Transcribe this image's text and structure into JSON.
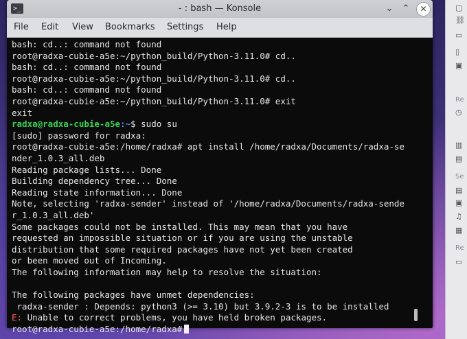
{
  "window": {
    "title": "- : bash — Konsole",
    "app_icon": "terminal-icon",
    "minimize_glyph": "⌄",
    "maximize_glyph": "⌃",
    "close_glyph": "✕"
  },
  "menu": [
    "File",
    "Edit",
    "View",
    "Bookmarks",
    "Settings",
    "Help"
  ],
  "terminal": {
    "lines": [
      "bash: cd..: command not found",
      "root@radxa-cubie-a5e:~/python_build/Python-3.11.0# cd..",
      "bash: cd..: command not found",
      "root@radxa-cubie-a5e:~/python_build/Python-3.11.0# cd..",
      "bash: cd..: command not found",
      "root@radxa-cubie-a5e:~/python_build/Python-3.11.0# exit",
      "exit"
    ],
    "prompt_user": "radxa@radxa-cubie-a5e",
    "prompt_path": ":~",
    "prompt_cmd": "$ sudo su",
    "lines2": [
      "[sudo] password for radxa:",
      "root@radxa-cubie-a5e:/home/radxa# apt install /home/radxa/Documents/radxa-se",
      "nder_1.0.3_all.deb",
      "Reading package lists... Done",
      "Building dependency tree... Done",
      "Reading state information... Done",
      "Note, selecting 'radxa-sender' instead of '/home/radxa/Documents/radxa-sende",
      "r_1.0.3_all.deb'",
      "Some packages could not be installed. This may mean that you have",
      "requested an impossible situation or if you are using the unstable",
      "distribution that some required packages have not yet been created",
      "or been moved out of Incoming.",
      "The following information may help to resolve the situation:",
      "",
      "The following packages have unmet dependencies:",
      " radxa-sender : Depends: python3 (>= 3.10) but 3.9.2-3 is to be installed"
    ],
    "error_prefix": "E:",
    "error_text": " Unable to correct problems, you have held broken packages.",
    "final_prompt": "root@radxa-cubie-a5e:/home/radxa#"
  },
  "side_panel": {
    "labels": [
      "Re",
      "Se",
      "Re"
    ]
  }
}
